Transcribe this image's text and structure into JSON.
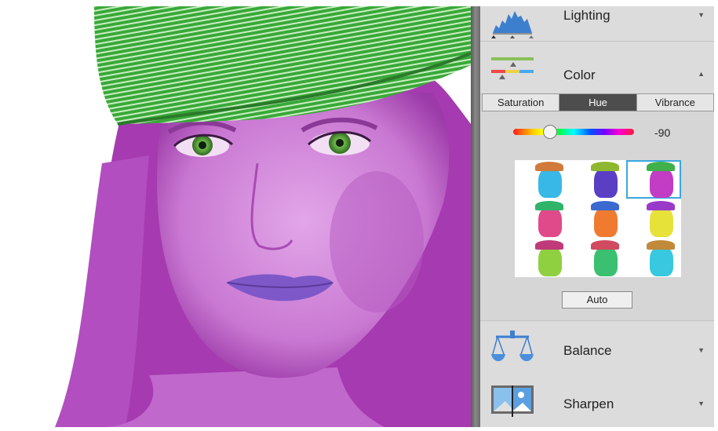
{
  "panel": {
    "lighting": {
      "label": "Lighting"
    },
    "color": {
      "label": "Color",
      "tabs": [
        "Saturation",
        "Hue",
        "Vibrance"
      ],
      "active_tab": "Hue",
      "hue_value": "-90",
      "auto_label": "Auto",
      "selected_variation": 3
    },
    "balance": {
      "label": "Balance"
    },
    "sharpen": {
      "label": "Sharpen"
    }
  },
  "variations": [
    {
      "face": "#38b8e6",
      "cap": "#d07a3c"
    },
    {
      "face": "#5a3fc4",
      "cap": "#8fb830"
    },
    {
      "face": "#c23cc4",
      "cap": "#3fb04a"
    },
    {
      "face": "#e04a8a",
      "cap": "#2fb46a"
    },
    {
      "face": "#f07a30",
      "cap": "#3a6ad0"
    },
    {
      "face": "#e6e23a",
      "cap": "#9a3ac8"
    },
    {
      "face": "#8fd040",
      "cap": "#c03a7a"
    },
    {
      "face": "#3ac070",
      "cap": "#d04a60"
    },
    {
      "face": "#38c8e0",
      "cap": "#c08a3a"
    }
  ]
}
